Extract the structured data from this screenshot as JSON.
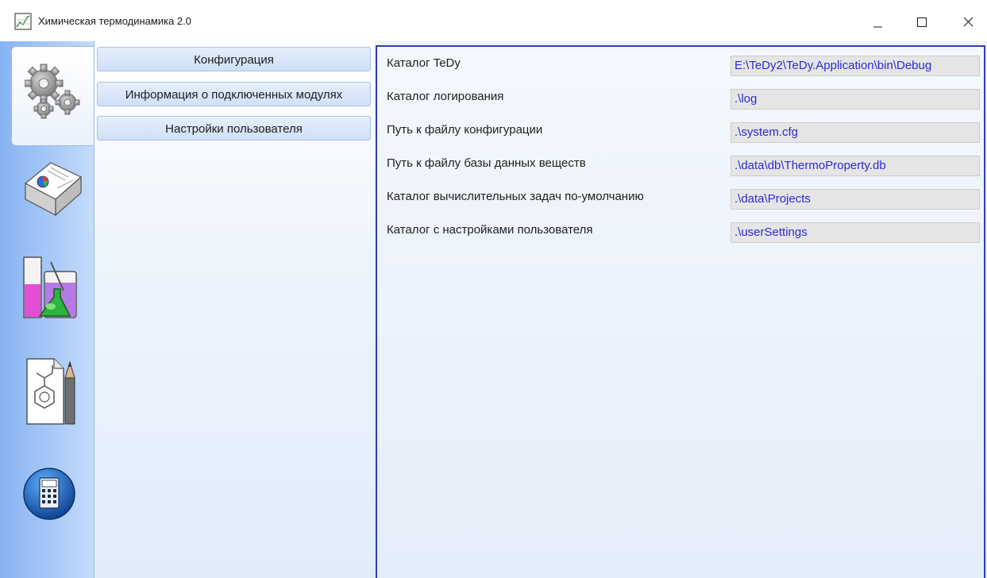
{
  "window": {
    "title": "Химическая термодинамика 2.0",
    "app_icon": "chart-icon",
    "buttons": [
      "minimize-icon",
      "maximize-icon",
      "close-icon"
    ]
  },
  "sidebar": {
    "tabs": [
      {
        "icon": "gears-icon",
        "selected": true
      },
      {
        "icon": "documents-icon",
        "selected": false
      },
      {
        "icon": "lab-flask-icon",
        "selected": false
      },
      {
        "icon": "molecule-drawing-icon",
        "selected": false
      },
      {
        "icon": "calculator-icon",
        "selected": false
      }
    ]
  },
  "nav": {
    "items": [
      {
        "label": "Конфигурация"
      },
      {
        "label": "Информация о подключенных модулях"
      },
      {
        "label": "Настройки пользователя"
      }
    ]
  },
  "config": {
    "rows": [
      {
        "label": "Каталог TeDy",
        "value": "E:\\TeDy2\\TeDy.Application\\bin\\Debug"
      },
      {
        "label": "Каталог логирования",
        "value": ".\\log"
      },
      {
        "label": "Путь к файлу конфигурации",
        "value": ".\\system.cfg"
      },
      {
        "label": "Путь к файлу базы данных веществ",
        "value": ".\\data\\db\\ThermoProperty.db"
      },
      {
        "label": "Каталог вычислительных задач по-умолчанию",
        "value": ".\\data\\Projects"
      },
      {
        "label": "Каталог с настройками пользователя",
        "value": ".\\userSettings"
      }
    ]
  },
  "colors": {
    "accent_border": "#2e3fb0",
    "value_text": "#2b2bd8",
    "sidebar_blue": "#87b3f3"
  }
}
